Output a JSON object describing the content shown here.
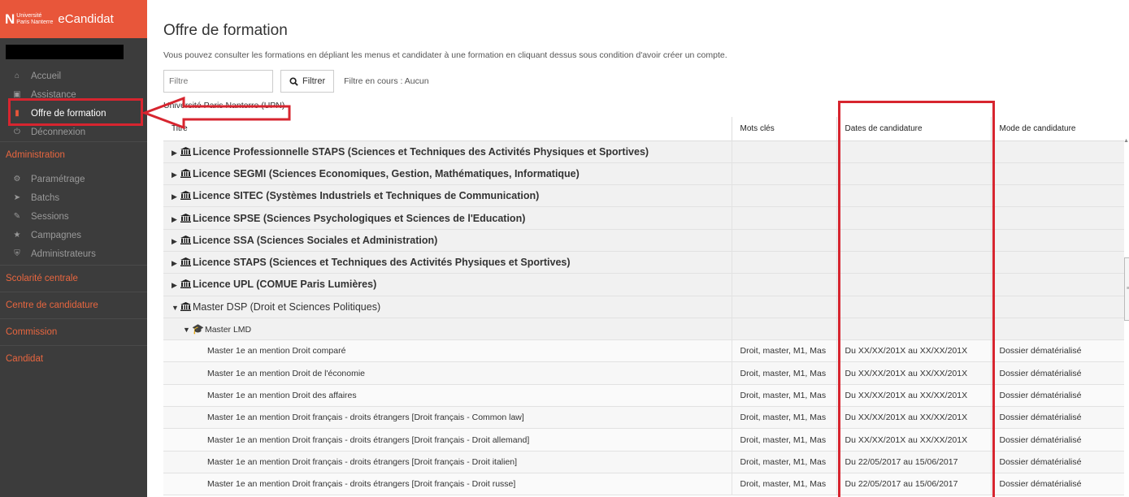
{
  "brand": {
    "logo_mark": "N",
    "univ_line1": "Université",
    "univ_line2": "Paris Nanterre",
    "app_name": "eCandidat"
  },
  "sidebar": {
    "main_items": [
      {
        "label": "Accueil",
        "icon": "home-icon"
      },
      {
        "label": "Assistance",
        "icon": "assistance-icon"
      },
      {
        "label": "Offre de formation",
        "icon": "bookmark-icon",
        "active": true
      },
      {
        "label": "Déconnexion",
        "icon": "power-icon"
      }
    ],
    "admin_section": "Administration",
    "admin_items": [
      {
        "label": "Paramétrage",
        "icon": "gears-icon"
      },
      {
        "label": "Batchs",
        "icon": "rocket-icon"
      },
      {
        "label": "Sessions",
        "icon": "wrench-icon"
      },
      {
        "label": "Campagnes",
        "icon": "star-icon"
      },
      {
        "label": "Administrateurs",
        "icon": "shield-icon"
      }
    ],
    "sections": [
      "Scolarité centrale",
      "Centre de candidature",
      "Commission",
      "Candidat"
    ]
  },
  "main": {
    "title": "Offre de formation",
    "intro": "Vous pouvez consulter les formations en dépliant les menus et candidater à une formation en cliquant dessus sous condition d'avoir créer un compte.",
    "filter": {
      "placeholder": "Filtre",
      "button_label": "Filtrer",
      "status": "Filtre en cours : Aucun"
    },
    "university": "Université Paris Nanterre (UPN)",
    "columns": [
      "Titre",
      "Mots clés",
      "Dates de candidature",
      "Mode de candidature"
    ],
    "rows": [
      {
        "type": "grp",
        "title": "Licence Professionnelle STAPS (Sciences et Techniques des Activités Physiques et Sportives)",
        "keywords": "",
        "dates": "",
        "mode": ""
      },
      {
        "type": "grp",
        "title": "Licence SEGMI (Sciences Economiques, Gestion, Mathématiques, Informatique)",
        "keywords": "",
        "dates": "",
        "mode": ""
      },
      {
        "type": "grp",
        "title": "Licence SITEC (Systèmes Industriels et Techniques de Communication)",
        "keywords": "",
        "dates": "",
        "mode": ""
      },
      {
        "type": "grp",
        "title": "Licence SPSE (Sciences Psychologiques et Sciences de l'Education)",
        "keywords": "",
        "dates": "",
        "mode": ""
      },
      {
        "type": "grp",
        "title": "Licence SSA (Sciences Sociales et Administration)",
        "keywords": "",
        "dates": "",
        "mode": ""
      },
      {
        "type": "grp",
        "title": "Licence STAPS (Sciences et Techniques des Activités Physiques et Sportives)",
        "keywords": "",
        "dates": "",
        "mode": ""
      },
      {
        "type": "grp",
        "title": "Licence UPL (COMUE Paris Lumières)",
        "keywords": "",
        "dates": "",
        "mode": ""
      },
      {
        "type": "grp-open",
        "title": "Master DSP (Droit et Sciences Politiques)",
        "keywords": "",
        "dates": "",
        "mode": ""
      },
      {
        "type": "sub",
        "title": "Master LMD",
        "keywords": "",
        "dates": "",
        "mode": ""
      },
      {
        "type": "leaf",
        "title": "Master 1e an mention Droit comparé",
        "keywords": "Droit, master, M1, Mas",
        "dates": "Du XX/XX/201X au XX/XX/201X",
        "mode": "Dossier dématérialisé"
      },
      {
        "type": "leaf",
        "title": "Master 1e an mention Droit de l'économie",
        "keywords": "Droit, master, M1, Mas",
        "dates": "Du XX/XX/201X au XX/XX/201X",
        "mode": "Dossier dématérialisé"
      },
      {
        "type": "leaf",
        "title": "Master 1e an mention Droit des affaires",
        "keywords": "Droit, master, M1, Mas",
        "dates": "Du XX/XX/201X au XX/XX/201X",
        "mode": "Dossier dématérialisé"
      },
      {
        "type": "leaf",
        "title": "Master 1e an mention Droit français - droits étrangers [Droit français - Common law]",
        "keywords": "Droit, master, M1, Mas",
        "dates": "Du XX/XX/201X au XX/XX/201X",
        "mode": "Dossier dématérialisé"
      },
      {
        "type": "leaf",
        "title": "Master 1e an mention Droit français - droits étrangers [Droit français - Droit allemand]",
        "keywords": "Droit, master, M1, Mas",
        "dates": "Du XX/XX/201X au XX/XX/201X",
        "mode": "Dossier dématérialisé"
      },
      {
        "type": "leaf",
        "title": "Master 1e an mention Droit français - droits étrangers [Droit français - Droit italien]",
        "keywords": "Droit, master, M1, Mas",
        "dates": "Du 22/05/2017 au 15/06/2017",
        "mode": "Dossier dématérialisé"
      },
      {
        "type": "leaf",
        "title": "Master 1e an mention Droit français - droits étrangers [Droit français - Droit russe]",
        "keywords": "Droit, master, M1, Mas",
        "dates": "Du 22/05/2017 au 15/06/2017",
        "mode": "Dossier dématérialisé"
      }
    ]
  },
  "colors": {
    "brand": "#e8563a",
    "sidebar_bg": "#3c3c3c",
    "annotation": "#d7252f"
  }
}
